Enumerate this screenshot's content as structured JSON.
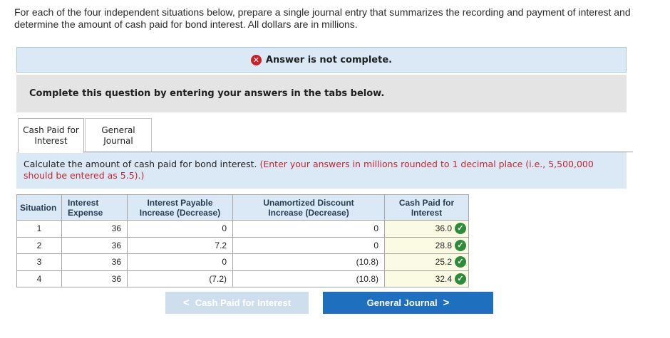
{
  "intro_text": "For each of the four independent situations below, prepare a single journal entry that summarizes the recording and payment of interest and determine the amount of cash paid for bond interest. All dollars are in millions.",
  "banner": {
    "text": "Answer is not complete.",
    "icon": "x-circle-icon",
    "icon_glyph": "✕"
  },
  "instruction": "Complete this question by entering your answers in the tabs below.",
  "tabs": [
    {
      "label_line1": "Cash Paid for",
      "label_line2": "Interest",
      "active": true
    },
    {
      "label_line1": "General",
      "label_line2": "Journal",
      "active": false
    }
  ],
  "calc": {
    "prefix": "Calculate the amount of cash paid for bond interest.",
    "note": "(Enter your answers in millions rounded to 1 decimal place (i.e., 5,500,000 should be entered as 5.5).)"
  },
  "table": {
    "headers": {
      "situation": "Situation",
      "interest_expense_1": "Interest",
      "interest_expense_2": "Expense",
      "interest_payable_1": "Interest Payable",
      "interest_payable_2": "Increase (Decrease)",
      "unamortized_1": "Unamortized Discount",
      "unamortized_2": "Increase (Decrease)",
      "cash_paid_1": "Cash Paid for",
      "cash_paid_2": "Interest"
    },
    "rows": [
      {
        "situation": "1",
        "interest_expense": "36",
        "interest_payable": "0",
        "unamortized": "0",
        "cash_paid": "36.0",
        "status": "check-icon"
      },
      {
        "situation": "2",
        "interest_expense": "36",
        "interest_payable": "7.2",
        "unamortized": "0",
        "cash_paid": "28.8",
        "status": "check-icon"
      },
      {
        "situation": "3",
        "interest_expense": "36",
        "interest_payable": "0",
        "unamortized": "(10.8)",
        "cash_paid": "25.2",
        "status": "check-icon"
      },
      {
        "situation": "4",
        "interest_expense": "36",
        "interest_payable": "(7.2)",
        "unamortized": "(10.8)",
        "cash_paid": "32.4",
        "status": "check-icon"
      }
    ],
    "check_glyph": "✓"
  },
  "nav": {
    "prev_label": "Cash Paid for Interest",
    "prev_glyph": "<",
    "next_label": "General Journal",
    "next_glyph": ">"
  },
  "colors": {
    "banner_bg": "#dbe9f6",
    "error_red": "#cc2027",
    "note_red": "#c0262d",
    "success_green": "#2e8b3a",
    "primary_button": "#1f6fbf",
    "disabled_button": "#cfdeee"
  }
}
